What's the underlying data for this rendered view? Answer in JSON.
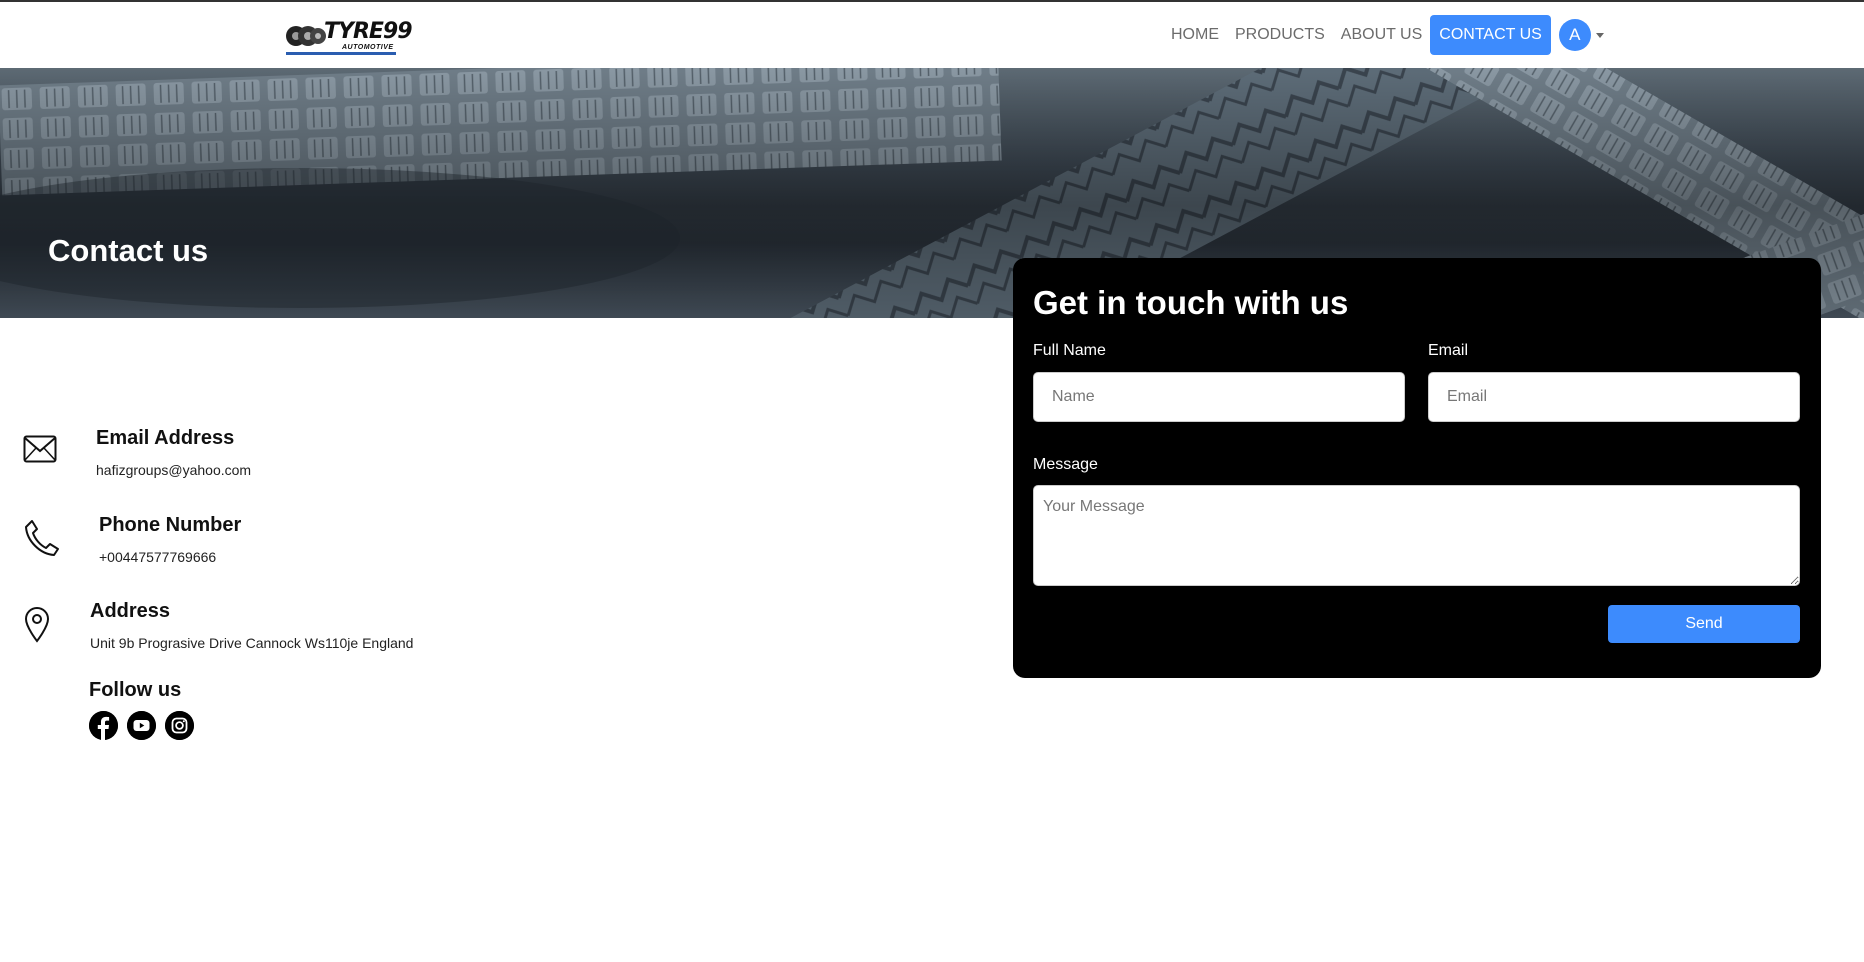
{
  "nav": {
    "brand": "TYRE99",
    "brand_sub": "AUTOMOTIVE",
    "links": [
      {
        "label": "HOME"
      },
      {
        "label": "PRODUCTS"
      },
      {
        "label": "ABOUT US"
      },
      {
        "label": "CONTACT US",
        "active": true
      }
    ],
    "avatar_initial": "A"
  },
  "hero": {
    "title": "Contact us"
  },
  "contact": {
    "email": {
      "title": "Email Address",
      "value": "hafizgroups@yahoo.com",
      "icon": "envelope-icon"
    },
    "phone": {
      "title": "Phone Number",
      "value": "+00447577769666",
      "icon": "phone-icon"
    },
    "address": {
      "title": "Address",
      "value": "Unit 9b Prograsive Drive Cannock Ws110je England",
      "icon": "location-pin-icon"
    },
    "follow": {
      "title": "Follow us",
      "icons": [
        "facebook-icon",
        "youtube-icon",
        "instagram-icon"
      ]
    }
  },
  "form": {
    "title": "Get in touch with us",
    "full_name_label": "Full Name",
    "full_name_placeholder": "Name",
    "email_label": "Email",
    "email_placeholder": "Email",
    "message_label": "Message",
    "message_placeholder": "Your Message",
    "send_label": "Send"
  },
  "colors": {
    "accent": "#3d8bfd",
    "card_bg": "#000000",
    "logo_underline": "#2a5db0"
  }
}
